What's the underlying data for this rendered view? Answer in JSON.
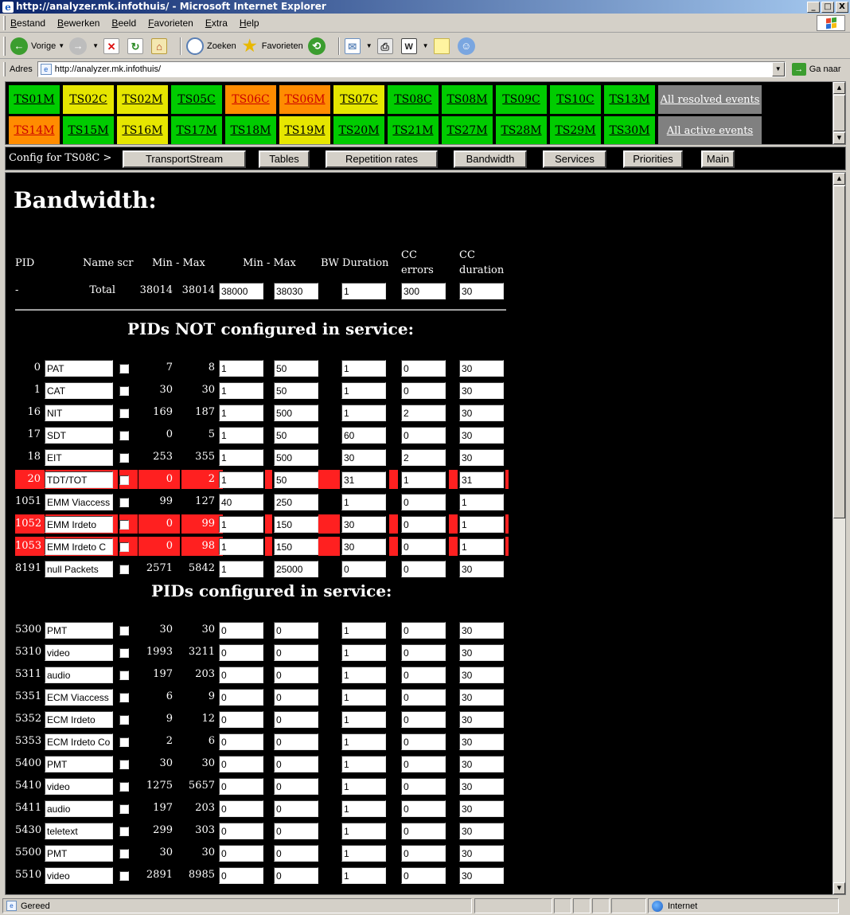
{
  "window": {
    "title": "http://analyzer.mk.infothuis/ - Microsoft Internet Explorer",
    "minimize": "_",
    "maximize": "□",
    "close": "X"
  },
  "menu": [
    "Bestand",
    "Bewerken",
    "Beeld",
    "Favorieten",
    "Extra",
    "Help"
  ],
  "toolbar": {
    "back": "Vorige",
    "search": "Zoeken",
    "favorites": "Favorieten"
  },
  "address": {
    "label": "Adres",
    "url": "http://analyzer.mk.infothuis/",
    "go": "Ga naar"
  },
  "ts_rows": [
    [
      {
        "label": "TS01M",
        "color": "green"
      },
      {
        "label": "TS02C",
        "color": "yellow"
      },
      {
        "label": "TS02M",
        "color": "yellow"
      },
      {
        "label": "TS05C",
        "color": "green"
      },
      {
        "label": "TS06C",
        "color": "orange"
      },
      {
        "label": "TS06M",
        "color": "orange"
      },
      {
        "label": "TS07C",
        "color": "yellow"
      },
      {
        "label": "TS08C",
        "color": "green"
      },
      {
        "label": "TS08M",
        "color": "green"
      },
      {
        "label": "TS09C",
        "color": "green"
      },
      {
        "label": "TS10C",
        "color": "green"
      },
      {
        "label": "TS13M",
        "color": "green"
      },
      {
        "label": "All resolved events",
        "color": "events"
      }
    ],
    [
      {
        "label": "TS14M",
        "color": "orange"
      },
      {
        "label": "TS15M",
        "color": "green"
      },
      {
        "label": "TS16M",
        "color": "yellow"
      },
      {
        "label": "TS17M",
        "color": "green"
      },
      {
        "label": "TS18M",
        "color": "green"
      },
      {
        "label": "TS19M",
        "color": "yellow"
      },
      {
        "label": "TS20M",
        "color": "green"
      },
      {
        "label": "TS21M",
        "color": "green"
      },
      {
        "label": "TS27M",
        "color": "green"
      },
      {
        "label": "TS28M",
        "color": "green"
      },
      {
        "label": "TS29M",
        "color": "green"
      },
      {
        "label": "TS30M",
        "color": "green"
      },
      {
        "label": "All active events",
        "color": "events"
      }
    ]
  ],
  "status_colors": {
    "green": "#00cc00",
    "yellow": "#e6e600",
    "orange": "#ff8c00",
    "alert": "#ff2020",
    "events": "#808080"
  },
  "config": {
    "label": "Config for TS08C >",
    "buttons": [
      "TransportStream",
      "Tables",
      "Repetition rates",
      "Bandwidth",
      "Services",
      "Priorities",
      "Main"
    ]
  },
  "page": {
    "heading": "Bandwidth:",
    "headers": {
      "pid": "PID",
      "name_scr": "Name scr",
      "min_max_measured": "Min - Max",
      "min_max_config": "Min - Max",
      "bw_duration": "BW Duration",
      "cc_errors": "CC errors",
      "cc_duration": "CC duration"
    },
    "total": {
      "pid": "-",
      "name": "Total",
      "min": "38014",
      "max": "38014",
      "cfg_min": "38000",
      "cfg_max": "38030",
      "bw_dur": "1",
      "cc_err": "300",
      "cc_dur": "30"
    },
    "section_not_configured": "PIDs NOT configured in service:",
    "section_configured": "PIDs configured in service:"
  },
  "not_configured": [
    {
      "pid": "0",
      "name": "PAT",
      "min": "7",
      "max": "8",
      "cfg_min": "1",
      "cfg_max": "50",
      "bw_dur": "1",
      "cc_err": "0",
      "cc_dur": "30",
      "alert": false
    },
    {
      "pid": "1",
      "name": "CAT",
      "min": "30",
      "max": "30",
      "cfg_min": "1",
      "cfg_max": "50",
      "bw_dur": "1",
      "cc_err": "0",
      "cc_dur": "30",
      "alert": false
    },
    {
      "pid": "16",
      "name": "NIT",
      "min": "169",
      "max": "187",
      "cfg_min": "1",
      "cfg_max": "500",
      "bw_dur": "1",
      "cc_err": "2",
      "cc_dur": "30",
      "alert": false
    },
    {
      "pid": "17",
      "name": "SDT",
      "min": "0",
      "max": "5",
      "cfg_min": "1",
      "cfg_max": "50",
      "bw_dur": "60",
      "cc_err": "0",
      "cc_dur": "30",
      "alert": false
    },
    {
      "pid": "18",
      "name": "EIT",
      "min": "253",
      "max": "355",
      "cfg_min": "1",
      "cfg_max": "500",
      "bw_dur": "30",
      "cc_err": "2",
      "cc_dur": "30",
      "alert": false
    },
    {
      "pid": "20",
      "name": "TDT/TOT",
      "min": "0",
      "max": "2",
      "cfg_min": "1",
      "cfg_max": "50",
      "bw_dur": "31",
      "cc_err": "1",
      "cc_dur": "31",
      "alert": true
    },
    {
      "pid": "1051",
      "name": "EMM Viaccess",
      "min": "99",
      "max": "127",
      "cfg_min": "40",
      "cfg_max": "250",
      "bw_dur": "1",
      "cc_err": "0",
      "cc_dur": "1",
      "alert": false
    },
    {
      "pid": "1052",
      "name": "EMM Irdeto",
      "min": "0",
      "max": "99",
      "cfg_min": "1",
      "cfg_max": "150",
      "bw_dur": "30",
      "cc_err": "0",
      "cc_dur": "1",
      "alert": true
    },
    {
      "pid": "1053",
      "name": "EMM Irdeto C",
      "min": "0",
      "max": "98",
      "cfg_min": "1",
      "cfg_max": "150",
      "bw_dur": "30",
      "cc_err": "0",
      "cc_dur": "1",
      "alert": true
    },
    {
      "pid": "8191",
      "name": "null Packets",
      "min": "2571",
      "max": "5842",
      "cfg_min": "1",
      "cfg_max": "25000",
      "bw_dur": "0",
      "cc_err": "0",
      "cc_dur": "30",
      "alert": false
    }
  ],
  "configured": [
    {
      "pid": "5300",
      "name": "PMT",
      "min": "30",
      "max": "30",
      "cfg_min": "0",
      "cfg_max": "0",
      "bw_dur": "1",
      "cc_err": "0",
      "cc_dur": "30"
    },
    {
      "pid": "5310",
      "name": "video",
      "min": "1993",
      "max": "3211",
      "cfg_min": "0",
      "cfg_max": "0",
      "bw_dur": "1",
      "cc_err": "0",
      "cc_dur": "30"
    },
    {
      "pid": "5311",
      "name": "audio",
      "min": "197",
      "max": "203",
      "cfg_min": "0",
      "cfg_max": "0",
      "bw_dur": "1",
      "cc_err": "0",
      "cc_dur": "30"
    },
    {
      "pid": "5351",
      "name": "ECM Viaccess",
      "min": "6",
      "max": "9",
      "cfg_min": "0",
      "cfg_max": "0",
      "bw_dur": "1",
      "cc_err": "0",
      "cc_dur": "30"
    },
    {
      "pid": "5352",
      "name": "ECM Irdeto",
      "min": "9",
      "max": "12",
      "cfg_min": "0",
      "cfg_max": "0",
      "bw_dur": "1",
      "cc_err": "0",
      "cc_dur": "30"
    },
    {
      "pid": "5353",
      "name": "ECM Irdeto Co",
      "min": "2",
      "max": "6",
      "cfg_min": "0",
      "cfg_max": "0",
      "bw_dur": "1",
      "cc_err": "0",
      "cc_dur": "30"
    },
    {
      "pid": "5400",
      "name": "PMT",
      "min": "30",
      "max": "30",
      "cfg_min": "0",
      "cfg_max": "0",
      "bw_dur": "1",
      "cc_err": "0",
      "cc_dur": "30"
    },
    {
      "pid": "5410",
      "name": "video",
      "min": "1275",
      "max": "5657",
      "cfg_min": "0",
      "cfg_max": "0",
      "bw_dur": "1",
      "cc_err": "0",
      "cc_dur": "30"
    },
    {
      "pid": "5411",
      "name": "audio",
      "min": "197",
      "max": "203",
      "cfg_min": "0",
      "cfg_max": "0",
      "bw_dur": "1",
      "cc_err": "0",
      "cc_dur": "30"
    },
    {
      "pid": "5430",
      "name": "teletext",
      "min": "299",
      "max": "303",
      "cfg_min": "0",
      "cfg_max": "0",
      "bw_dur": "1",
      "cc_err": "0",
      "cc_dur": "30"
    },
    {
      "pid": "5500",
      "name": "PMT",
      "min": "30",
      "max": "30",
      "cfg_min": "0",
      "cfg_max": "0",
      "bw_dur": "1",
      "cc_err": "0",
      "cc_dur": "30"
    },
    {
      "pid": "5510",
      "name": "video",
      "min": "2891",
      "max": "8985",
      "cfg_min": "0",
      "cfg_max": "0",
      "bw_dur": "1",
      "cc_err": "0",
      "cc_dur": "30"
    }
  ],
  "status": {
    "text": "Gereed",
    "zone": "Internet"
  }
}
